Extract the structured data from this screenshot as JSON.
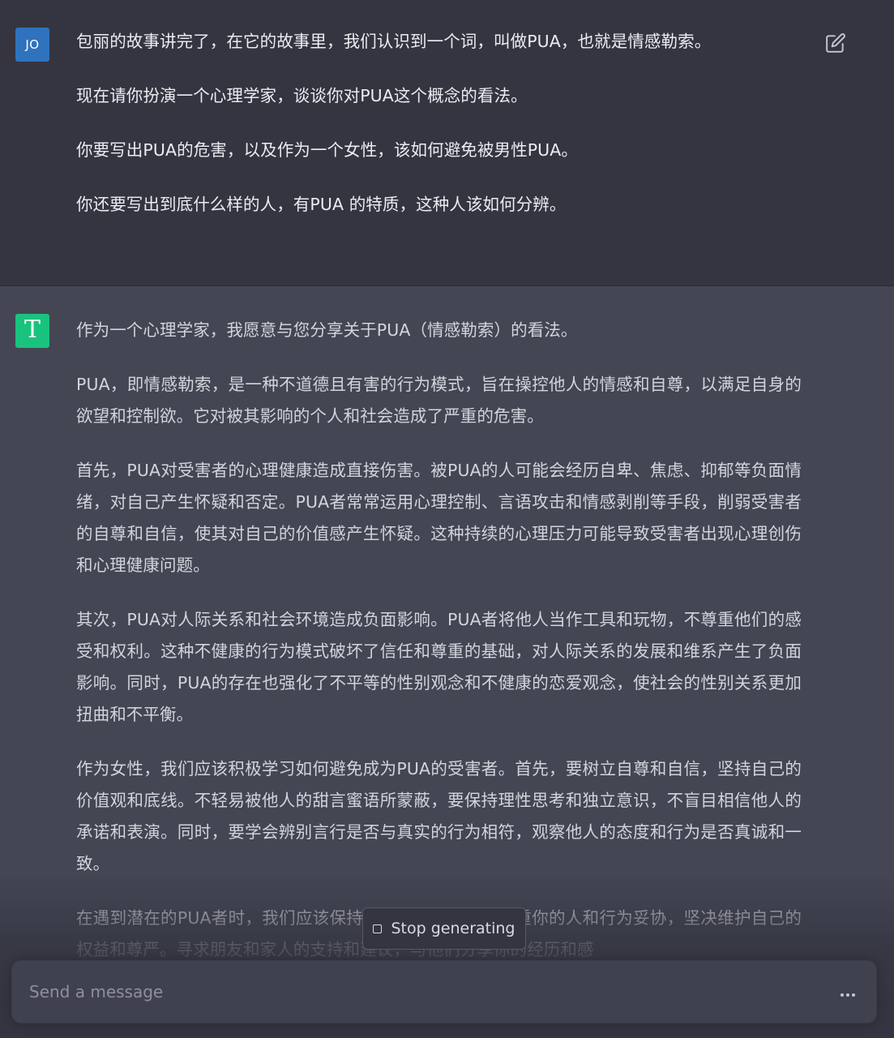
{
  "user_message": {
    "avatar_initials": "JO",
    "paragraphs": [
      "包丽的故事讲完了，在它的故事里，我们认识到一个词，叫做PUA，也就是情感勒索。",
      "现在请你扮演一个心理学家，谈谈你对PUA这个概念的看法。",
      "你要写出PUA的危害，以及作为一个女性，该如何避免被男性PUA。",
      "你还要写出到底什么样的人，有PUA 的特质，这种人该如何分辨。"
    ]
  },
  "assistant_message": {
    "avatar_glyph": "T",
    "paragraphs": [
      "作为一个心理学家，我愿意与您分享关于PUA（情感勒索）的看法。",
      "PUA，即情感勒索，是一种不道德且有害的行为模式，旨在操控他人的情感和自尊，以满足自身的欲望和控制欲。它对被其影响的个人和社会造成了严重的危害。",
      "首先，PUA对受害者的心理健康造成直接伤害。被PUA的人可能会经历自卑、焦虑、抑郁等负面情绪，对自己产生怀疑和否定。PUA者常常运用心理控制、言语攻击和情感剥削等手段，削弱受害者的自尊和自信，使其对自己的价值感产生怀疑。这种持续的心理压力可能导致受害者出现心理创伤和心理健康问题。",
      "其次，PUA对人际关系和社会环境造成负面影响。PUA者将他人当作工具和玩物，不尊重他们的感受和权利。这种不健康的行为模式破坏了信任和尊重的基础，对人际关系的发展和维系产生了负面影响。同时，PUA的存在也强化了不平等的性别观念和不健康的恋爱观念，使社会的性别关系更加扭曲和不平衡。",
      "作为女性，我们应该积极学习如何避免成为PUA的受害者。首先，要树立自尊和自信，坚持自己的价值观和底线。不轻易被他人的甜言蜜语所蒙蔽，要保持理性思考和独立意识，不盲目相信他人的承诺和表演。同时，要学会辨别言行是否与真实的行为相符，观察他人的态度和行为是否真诚和一致。",
      "在遇到潜在的PUA者时，我们应该保持警惕，不要对于不尊重你的人和行为妥协，坚决维护自己的权益和尊严。寻求朋友和家人的支持和建议，与他们分享你的经历和感"
    ]
  },
  "stop_button": {
    "label": "Stop generating"
  },
  "composer": {
    "placeholder": "Send a message",
    "value": ""
  },
  "colors": {
    "user_bg": "#343541",
    "assistant_bg": "#444654",
    "user_avatar": "#2f72bd",
    "assistant_avatar": "#19c37d"
  },
  "icons": {
    "edit": "edit-icon",
    "stop": "stop-icon",
    "more": "more-horizontal-icon"
  }
}
